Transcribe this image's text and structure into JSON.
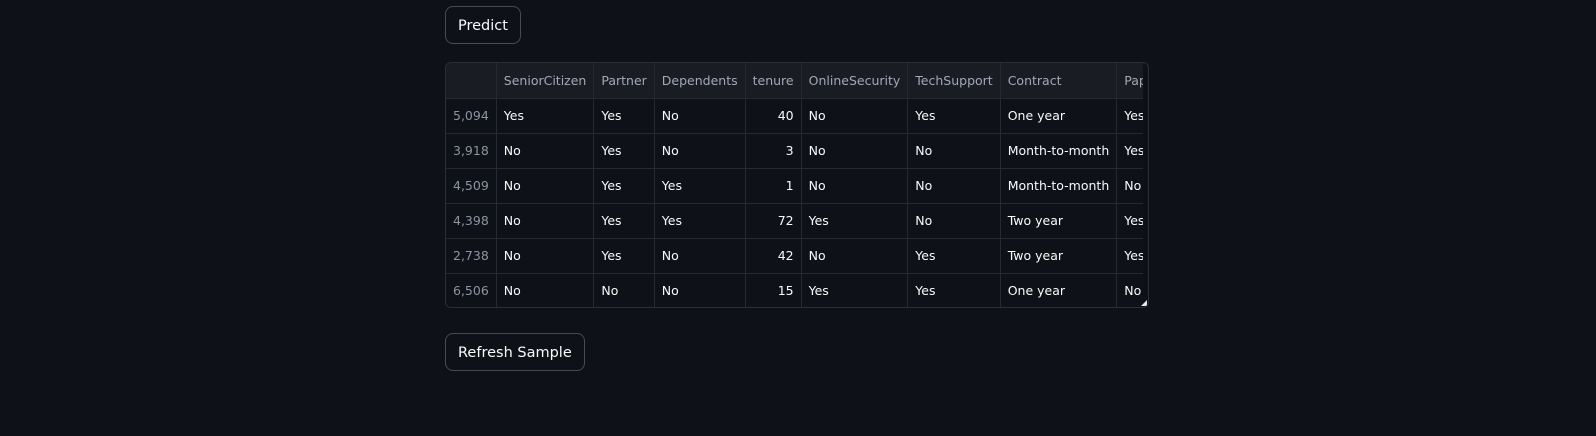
{
  "buttons": {
    "predict_label": "Predict",
    "refresh_label": "Refresh Sample"
  },
  "table": {
    "columns": [
      "",
      "SeniorCitizen",
      "Partner",
      "Dependents",
      "tenure",
      "OnlineSecurity",
      "TechSupport",
      "Contract",
      "Paper"
    ],
    "rows": [
      {
        "index": "5,094",
        "SeniorCitizen": "Yes",
        "Partner": "Yes",
        "Dependents": "No",
        "tenure": "40",
        "OnlineSecurity": "No",
        "TechSupport": "Yes",
        "Contract": "One year",
        "Paper": "Yes"
      },
      {
        "index": "3,918",
        "SeniorCitizen": "No",
        "Partner": "Yes",
        "Dependents": "No",
        "tenure": "3",
        "OnlineSecurity": "No",
        "TechSupport": "No",
        "Contract": "Month-to-month",
        "Paper": "Yes"
      },
      {
        "index": "4,509",
        "SeniorCitizen": "No",
        "Partner": "Yes",
        "Dependents": "Yes",
        "tenure": "1",
        "OnlineSecurity": "No",
        "TechSupport": "No",
        "Contract": "Month-to-month",
        "Paper": "No"
      },
      {
        "index": "4,398",
        "SeniorCitizen": "No",
        "Partner": "Yes",
        "Dependents": "Yes",
        "tenure": "72",
        "OnlineSecurity": "Yes",
        "TechSupport": "No",
        "Contract": "Two year",
        "Paper": "Yes"
      },
      {
        "index": "2,738",
        "SeniorCitizen": "No",
        "Partner": "Yes",
        "Dependents": "No",
        "tenure": "42",
        "OnlineSecurity": "No",
        "TechSupport": "Yes",
        "Contract": "Two year",
        "Paper": "Yes"
      },
      {
        "index": "6,506",
        "SeniorCitizen": "No",
        "Partner": "No",
        "Dependents": "No",
        "tenure": "15",
        "OnlineSecurity": "Yes",
        "TechSupport": "Yes",
        "Contract": "One year",
        "Paper": "No"
      }
    ]
  },
  "colors": {
    "background": "#0e1117",
    "header_bg": "#1a1c24",
    "border": "#262932",
    "text": "#fafafa",
    "muted_text": "#a3a8b8"
  }
}
